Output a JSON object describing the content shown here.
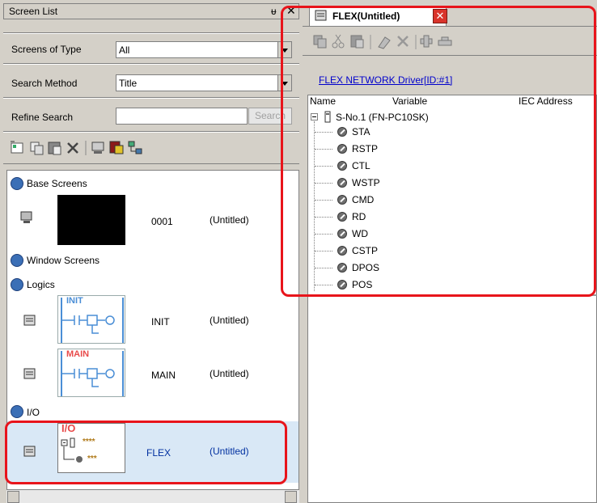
{
  "left_panel": {
    "title": "Screen List",
    "pin_glyph": "ᵾ",
    "close_glyph": "✕",
    "screens_of_type_label": "Screens of Type",
    "screens_of_type_value": "All",
    "search_method_label": "Search Method",
    "search_method_value": "Title",
    "refine_search_label": "Refine Search",
    "refine_search_value": "",
    "search_button": "Search",
    "categories": {
      "base": "Base Screens",
      "window": "Window Screens",
      "logics": "Logics",
      "io": "I/O"
    },
    "screens": {
      "base_0001": {
        "id": "0001",
        "title": "(Untitled)"
      },
      "init": {
        "id": "INIT",
        "title": "(Untitled)",
        "thumb_label": "INIT"
      },
      "main": {
        "id": "MAIN",
        "title": "(Untitled)",
        "thumb_label": "MAIN"
      },
      "flex": {
        "id": "FLEX",
        "title": "(Untitled)",
        "thumb_label": "I/O",
        "thumb_text_1": "****",
        "thumb_text_2": "***"
      }
    },
    "toolbar_icons": [
      "new-screen-icon",
      "copy-icon",
      "paste-icon",
      "delete-icon",
      "screen-view-icon",
      "move-icon",
      "network-icon"
    ]
  },
  "right_panel": {
    "tab_title": "FLEX(Untitled)",
    "driver_link": "FLEX NETWORK Driver[ID:#1]",
    "columns": {
      "name": "Name",
      "variable": "Variable",
      "iec": "IEC Address"
    },
    "root_node": "S-No.1 (FN-PC10SK)",
    "variables": [
      "STA",
      "RSTP",
      "CTL",
      "WSTP",
      "CMD",
      "RD",
      "WD",
      "CSTP",
      "DPOS",
      "POS"
    ],
    "toolbar_icons": [
      "copy-icon",
      "cut-icon",
      "paste-icon",
      "properties-icon",
      "delete-icon",
      "add-icon",
      "remove-icon"
    ]
  },
  "colors": {
    "highlight": "#e8141b",
    "panel_bg": "#d4d0c8",
    "selection": "#d9e8f6",
    "link": "#0000cc"
  }
}
